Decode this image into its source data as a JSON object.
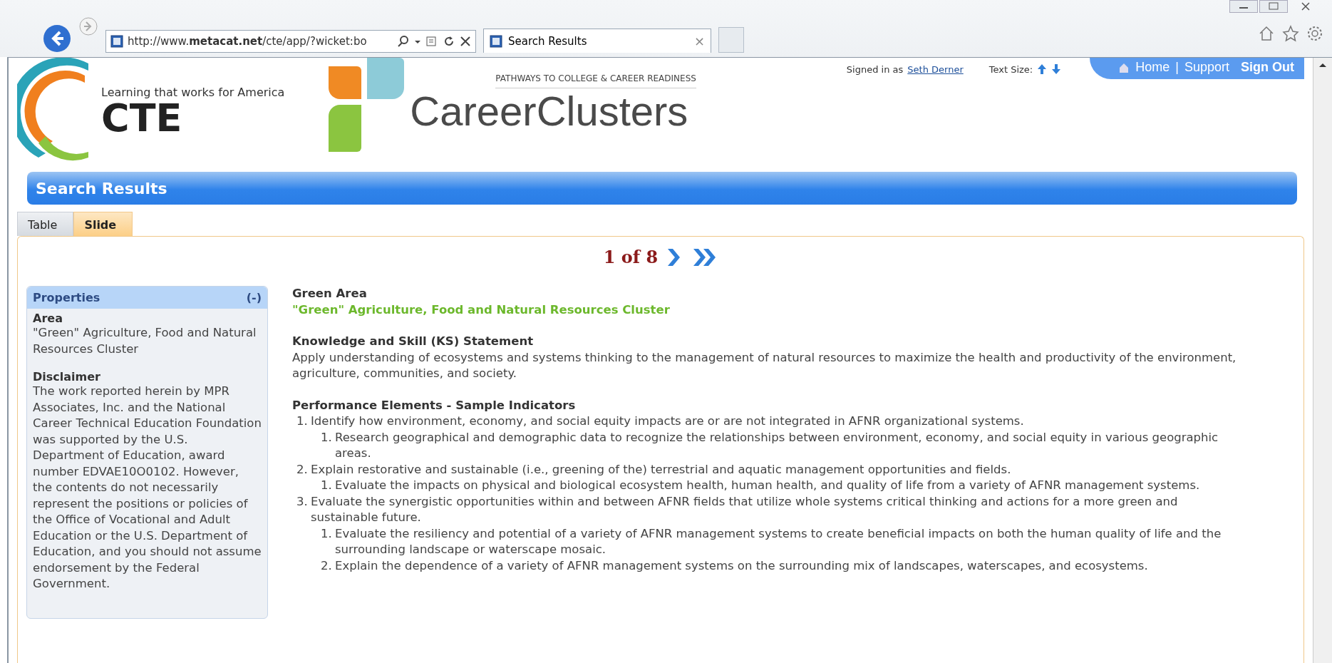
{
  "browser": {
    "address": "http://www.**metacat.net**/cte/app/?wicket:bo",
    "tab_title": "Search Results",
    "tab_close": "×"
  },
  "header": {
    "tagline": "Learning that works for America",
    "cte_logo": "CTE",
    "pathways": "PATHWAYS TO COLLEGE & CAREER READINESS",
    "clusters_logo": "CareerClusters",
    "signed_in_label": "Signed in as",
    "user": "Seth Derner",
    "text_size_label": "Text Size:",
    "nav": [
      {
        "label": "Home",
        "kind": "link"
      },
      {
        "label": "|",
        "kind": "separator"
      },
      {
        "label": "Support",
        "kind": "link"
      },
      {
        "label": "Sign Out",
        "kind": "strong"
      }
    ]
  },
  "page_title": "Search Results",
  "tabs": [
    {
      "label": "Table",
      "selected": false
    },
    {
      "label": "Slide",
      "selected": true
    }
  ],
  "pager": "1 of 8",
  "properties": {
    "title": "Properties",
    "toggle": "(-)",
    "sections": [
      {
        "heading": "Area",
        "text": "\"Green\" Agriculture, Food and Natural Resources Cluster"
      },
      {
        "heading": "Disclaimer",
        "text": "The work reported herein by MPR Associates, Inc. and the National Career Technical Education Foundation was supported by the U.S. Department of Education, award number EDVAE10O0102. However, the contents do not necessarily represent the positions or policies of the Office of Vocational and Adult Education or the U.S. Department of Education, and you should not assume endorsement by the Federal Government."
      }
    ]
  },
  "main": {
    "area_heading": "Green Area",
    "area_value": "\"Green\" Agriculture, Food and Natural Resources Cluster",
    "ks_heading": "Knowledge and Skill (KS) Statement",
    "ks_text": "Apply understanding of ecosystems and systems thinking to the management of natural resources to maximize the health and productivity of the environment, agriculture, communities, and society.",
    "pe_heading": "Performance Elements - Sample Indicators",
    "indicators": [
      {
        "number": "1.",
        "text": "Identify how environment, economy, and social equity impacts are or are not integrated in AFNR organizational systems.",
        "children": [
          {
            "number": "1.",
            "text": "Research geographical and demographic data to recognize the relationships between environment, economy, and social equity in various geographic areas."
          }
        ]
      },
      {
        "number": "2.",
        "text": "Explain restorative and sustainable (i.e., greening of the) terrestrial and aquatic management opportunities and fields.",
        "children": [
          {
            "number": "1.",
            "text": "Evaluate the impacts on physical and biological ecosystem health, human health, and quality of life from a variety of AFNR management systems."
          }
        ]
      },
      {
        "number": "3.",
        "text": "Evaluate the synergistic opportunities within and between AFNR fields that utilize whole systems critical thinking and actions for a more green and sustainable future.",
        "children": [
          {
            "number": "1.",
            "text": "Evaluate the resiliency and potential of a variety of AFNR management systems to create beneficial impacts on both the human quality of life and the surrounding landscape or waterscape mosaic."
          },
          {
            "number": "2.",
            "text": "Explain the dependence of a variety of AFNR management systems on the surrounding mix of landscapes, waterscapes, and ecosystems."
          }
        ]
      }
    ]
  }
}
